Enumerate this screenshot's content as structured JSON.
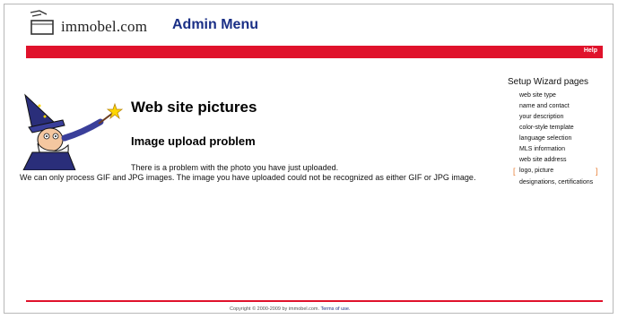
{
  "header": {
    "logo_text": "immobel.com",
    "admin_title": "Admin Menu",
    "help_label": "Help"
  },
  "main": {
    "title": "Web site pictures",
    "subtitle": "Image upload problem",
    "message_line1": "There is a problem with the photo you have just uploaded.",
    "message_line2": "We can only process GIF and JPG images. The image you have uploaded could not be recognized as either GIF or JPG image."
  },
  "sidebar": {
    "heading": "Setup Wizard pages",
    "items": [
      {
        "label": "web site type"
      },
      {
        "label": "name and contact"
      },
      {
        "label": "your description"
      },
      {
        "label": "color-style template"
      },
      {
        "label": "language selection"
      },
      {
        "label": "MLS information"
      },
      {
        "label": "web site address"
      },
      {
        "label": "logo, picture",
        "current": true
      },
      {
        "label": "designations, certifications"
      }
    ]
  },
  "footer": {
    "copyright": "Copyright © 2000-2009 by immobel.com.",
    "terms_label": "Terms of use."
  },
  "colors": {
    "brand_red": "#e0122b",
    "title_blue": "#1a2f86",
    "current_marker": "#e8823a"
  }
}
